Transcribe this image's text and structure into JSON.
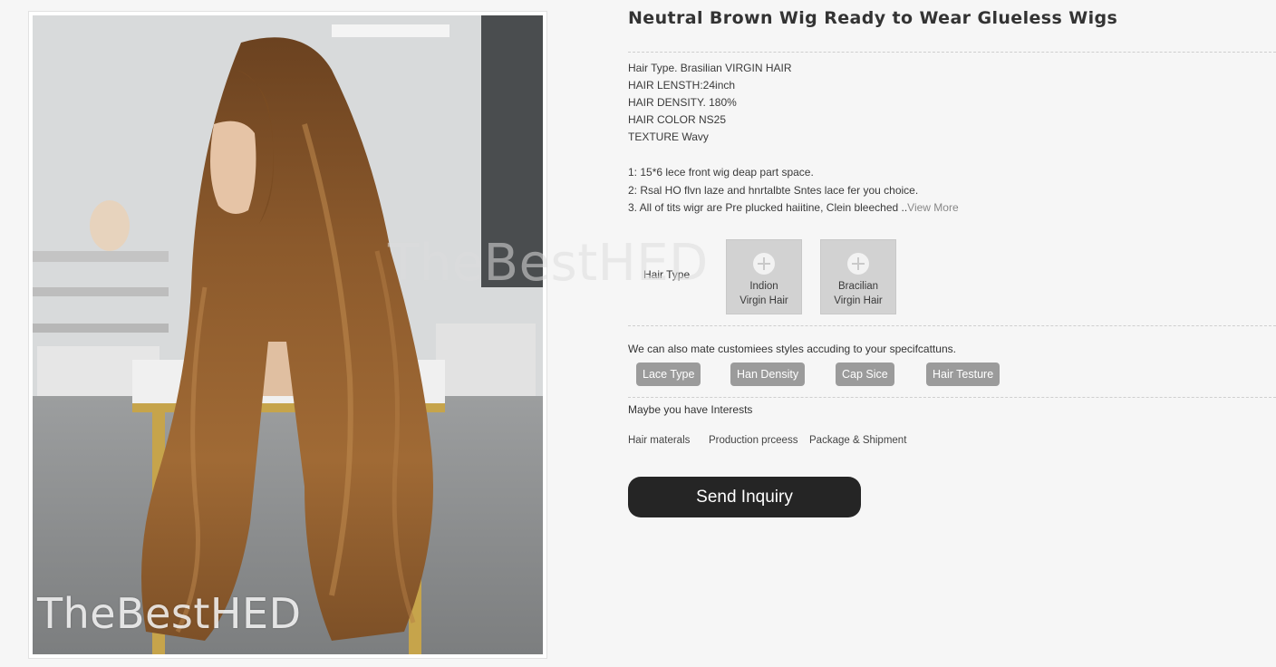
{
  "product": {
    "title": "Neutral Brown Wig Ready to Wear Glueless Wigs"
  },
  "watermark": {
    "photo": "TheBestHED",
    "center": "TheBestHED"
  },
  "specs": [
    "Hair Type. Brasilian VIRGIN HAIR",
    "HAIR LENSTH:24inch",
    "HAIR DENSITY. 180%",
    "HAIR COLOR NS25",
    "TEXTURE Wavy"
  ],
  "features": {
    "line1": "1:  15*6 lece front wig deap part space.",
    "line2": "2: Rsal HO flvn laze and hnrtalbte Sntes lace fer you choice.",
    "line3": "3. All of tits wigr are Pre plucked haiitine, Clein bleeched ..",
    "view_more": "View More"
  },
  "hair_type": {
    "label": "Hair Type",
    "options": [
      {
        "line1": "Indion",
        "line2": "Virgin Hair",
        "icon": "plus-icon"
      },
      {
        "line1": "Bracilian",
        "line2": "Virgin Hair",
        "icon": "plus-icon"
      }
    ]
  },
  "customize": {
    "text": "We can also mate customiees styles accuding to your specifcattuns.",
    "chips": [
      "Lace Type",
      "Han Density",
      "Cap Sice",
      "Hair Testure"
    ]
  },
  "interests": {
    "label": "Maybe you have Interests",
    "links": [
      "Hair materals",
      "Production prceess",
      "Package & Shipment"
    ]
  },
  "cta": {
    "label": "Send Inquiry"
  },
  "colors": {
    "button": "#252525",
    "chip": "#9b9b9b",
    "option_bg": "#d2d2d2",
    "hair": "#8a5a2b"
  }
}
